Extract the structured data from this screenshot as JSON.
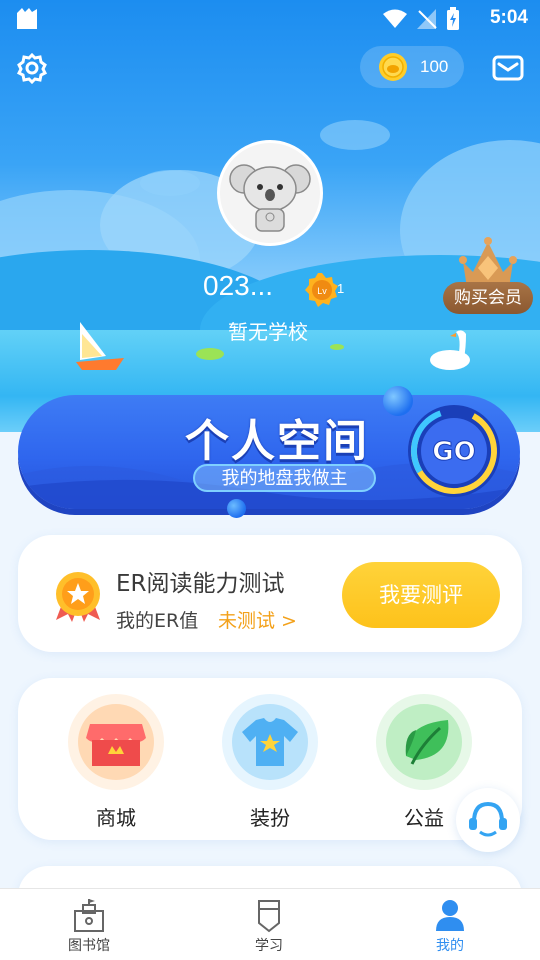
{
  "status_bar": {
    "time": "5:04"
  },
  "header": {
    "coins": "100"
  },
  "profile": {
    "username": "023...",
    "level_badge": "Lv",
    "level_num": "1",
    "school": "暂无学校",
    "vip_label": "购买会员"
  },
  "space_banner": {
    "title": "个人空间",
    "subtitle": "我的地盘我做主",
    "go_label": "GO"
  },
  "er_card": {
    "title": "ER阅读能力测试",
    "value_label": "我的ER值",
    "status": "未测试 >",
    "button": "我要测评"
  },
  "features": [
    {
      "label": "商城"
    },
    {
      "label": "装扮"
    },
    {
      "label": "公益"
    }
  ],
  "bottom_nav": [
    {
      "label": "图书馆"
    },
    {
      "label": "学习"
    },
    {
      "label": "我的"
    }
  ],
  "colors": {
    "brand_blue": "#2f8ef0",
    "banner_blue": "#2f66ee",
    "button_yellow": "#fdc21b",
    "status_orange": "#f3a11a",
    "vip_brown": "#9a6538"
  },
  "icons": [
    "settings-icon",
    "coin-icon",
    "mail-icon",
    "level-badge-icon",
    "crown-icon",
    "medal-icon",
    "shop-icon",
    "tshirt-icon",
    "leaf-icon",
    "headset-icon",
    "library-icon",
    "study-icon",
    "profile-icon"
  ]
}
